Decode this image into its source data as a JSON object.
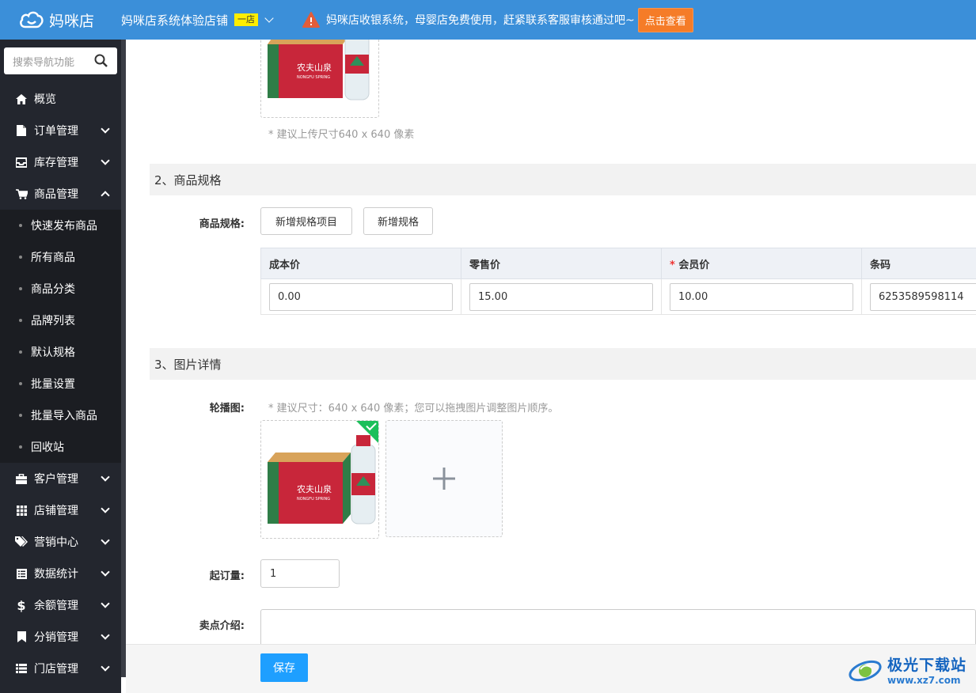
{
  "header": {
    "logo_text": "妈咪店",
    "store_name": "妈咪店系统体验店铺",
    "store_badge": "一店",
    "notice": "妈咪店收银系统，母婴店免费使用，赶紧联系客服审核通过吧~",
    "notice_button": "点击查看",
    "accent": "#3b8fd9"
  },
  "sidebar": {
    "search_placeholder": "搜索导航功能",
    "items": [
      {
        "label": "概览",
        "icon": "home-icon"
      },
      {
        "label": "订单管理",
        "icon": "file-icon"
      },
      {
        "label": "库存管理",
        "icon": "inbox-icon"
      },
      {
        "label": "商品管理",
        "icon": "cart-icon"
      },
      {
        "label": "客户管理",
        "icon": "briefcase-icon"
      },
      {
        "label": "店铺管理",
        "icon": "grid-icon"
      },
      {
        "label": "营销中心",
        "icon": "tag-icon"
      },
      {
        "label": "数据统计",
        "icon": "list-icon"
      },
      {
        "label": "余额管理",
        "icon": "dollar-icon"
      },
      {
        "label": "分销管理",
        "icon": "bookmark-icon"
      },
      {
        "label": "门店管理",
        "icon": "table-icon"
      }
    ],
    "subitems": [
      "快速发布商品",
      "所有商品",
      "商品分类",
      "品牌列表",
      "默认规格",
      "批量设置",
      "批量导入商品",
      "回收站"
    ]
  },
  "main": {
    "upload_hint": "* 建议上传尺寸640 x 640 像素",
    "section2_title": "2、商品规格",
    "spec_label": "商品规格:",
    "add_spec_item_btn": "新增规格项目",
    "add_spec_btn": "新增规格",
    "table_headers": [
      "成本价",
      "零售价",
      "会员价",
      "条码"
    ],
    "required_mark": "*",
    "row": {
      "cost": "0.00",
      "retail": "15.00",
      "member": "10.00",
      "barcode": "6253589598114"
    },
    "section3_title": "3、图片详情",
    "carousel_label": "轮播图:",
    "carousel_hint": "* 建议尺寸：640 x 640 像素；您可以拖拽图片调整图片顺序。",
    "min_order_label": "起订量:",
    "min_order_value": "1",
    "selling_point_label": "卖点介绍:",
    "save_button": "保存",
    "product_brand": "农夫山泉",
    "product_brand_en": "NONGFU SPRING"
  },
  "watermark": {
    "title": "极光下载站",
    "url": "www.xz7.com"
  }
}
